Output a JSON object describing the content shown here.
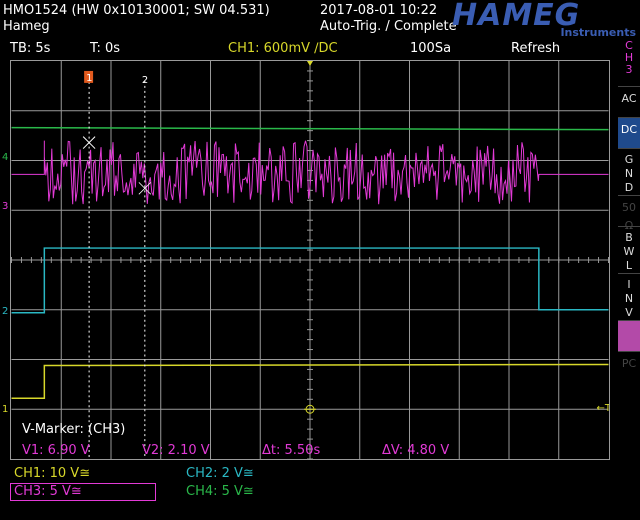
{
  "header": {
    "model": "HMO1524 (HW 0x10130001; SW 04.531)",
    "owner": "Hameg",
    "datetime": "2017-08-01 10:22",
    "trigger_status": "Auto-Trig. / Complete",
    "logo": "HAMEG",
    "logo_sub": "Instruments"
  },
  "status": {
    "timebase": "TB: 5s",
    "time": "T: 0s",
    "channel": "CH1: 600mV ∕DC",
    "samples": "100Sa",
    "mode": "Refresh"
  },
  "right_panel": {
    "channel": [
      "C",
      "H",
      "3"
    ],
    "buttons": [
      {
        "label": "AC",
        "state": "normal"
      },
      {
        "label": "DC",
        "state": "active"
      },
      {
        "label": "G N D",
        "state": "normal"
      },
      {
        "label": "50 Ω",
        "state": "dim"
      },
      {
        "label": "B W L",
        "state": "normal"
      },
      {
        "label": "I N V",
        "state": "normal"
      },
      {
        "label": "",
        "state": "pink"
      },
      {
        "label": "PC",
        "state": "dim"
      }
    ]
  },
  "markers": {
    "m1": "1",
    "m2": "2",
    "vmarker_title": "V-Marker: (CH3)",
    "v1": "V1: 6.90 V",
    "v2": "V2: 2.10 V",
    "dt": "Δt: 5.50s",
    "dv": "ΔV: 4.80 V"
  },
  "channels": {
    "ch1": {
      "label": "CH1: 10 V≅",
      "color": "#d8d82a"
    },
    "ch2": {
      "label": "CH2: 2 V≅",
      "color": "#2ab8c4"
    },
    "ch3": {
      "label": "CH3: 5 V≅",
      "color": "#e23ad6"
    },
    "ch4": {
      "label": "CH4: 5 V≅",
      "color": "#2ab84a"
    }
  },
  "channel_markers": {
    "ch1": "1",
    "ch2": "2",
    "ch3": "3",
    "ch4": "4"
  },
  "colors": {
    "ch1": "#d8d82a",
    "ch2": "#2ab8c4",
    "ch3": "#e23ad6",
    "ch4": "#2ab84a",
    "grid": "#9a9a9a"
  }
}
